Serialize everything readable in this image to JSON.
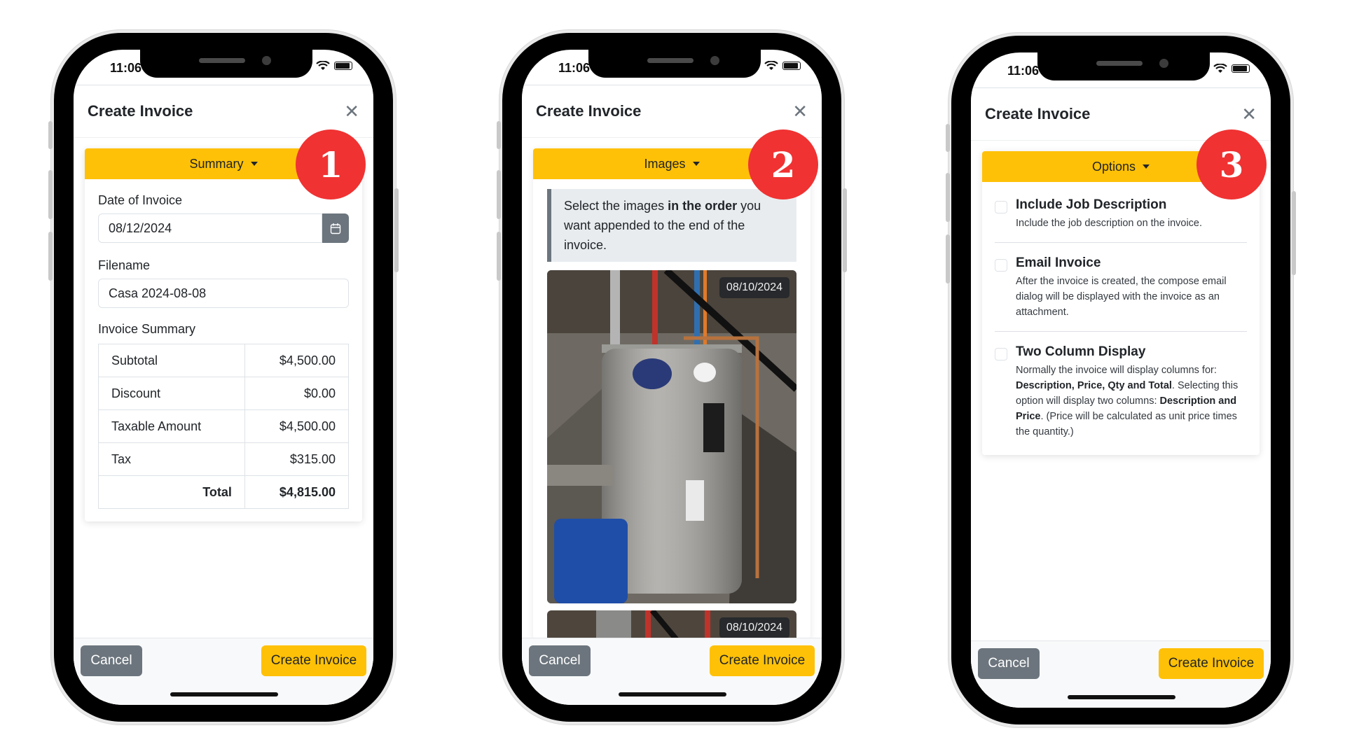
{
  "status_bar": {
    "time": "11:06",
    "wifi_icon": "wifi-icon",
    "battery_icon": "battery-icon"
  },
  "modal": {
    "title": "Create Invoice",
    "close_icon": "close-icon",
    "footer": {
      "cancel_label": "Cancel",
      "create_label": "Create Invoice"
    }
  },
  "badges": [
    "1",
    "2",
    "3"
  ],
  "colors": {
    "accent": "#ffc107",
    "badge": "#f03232",
    "secondary": "#6c757d"
  },
  "summary_panel": {
    "header": "Summary",
    "date_label": "Date of Invoice",
    "date_value": "08/12/2024",
    "calendar_icon": "calendar-icon",
    "filename_label": "Filename",
    "filename_value": "Casa 2024-08-08",
    "summary_label": "Invoice Summary",
    "rows": [
      {
        "label": "Subtotal",
        "value": "$4,500.00"
      },
      {
        "label": "Discount",
        "value": "$0.00"
      },
      {
        "label": "Taxable Amount",
        "value": "$4,500.00"
      },
      {
        "label": "Tax",
        "value": "$315.00"
      }
    ],
    "total": {
      "label": "Total",
      "value": "$4,815.00"
    }
  },
  "images_panel": {
    "header": "Images",
    "note_pre": "Select the images ",
    "note_bold": "in the order",
    "note_post": " you want appended to the end of the invoice.",
    "photos": [
      {
        "date": "08/10/2024",
        "subject": "water heater"
      },
      {
        "date": "08/10/2024",
        "subject": "water heater pipes"
      }
    ]
  },
  "options_panel": {
    "header": "Options",
    "options": [
      {
        "title": "Include Job Description",
        "desc": "Include the job description on the invoice.",
        "checked": false
      },
      {
        "title": "Email Invoice",
        "desc": "After the invoice is created, the compose email dialog will be displayed with the invoice as an attachment.",
        "checked": false
      },
      {
        "title": "Two Column Display",
        "desc_1": "Normally the invoice will display columns for: ",
        "desc_bold_1": "Description, Price, Qty and Total",
        "desc_2": ". Selecting this option will display two columns: ",
        "desc_bold_2": "Description and Price",
        "desc_3": ". (Price will be calculated as unit price times the quantity.)",
        "checked": false
      }
    ]
  }
}
